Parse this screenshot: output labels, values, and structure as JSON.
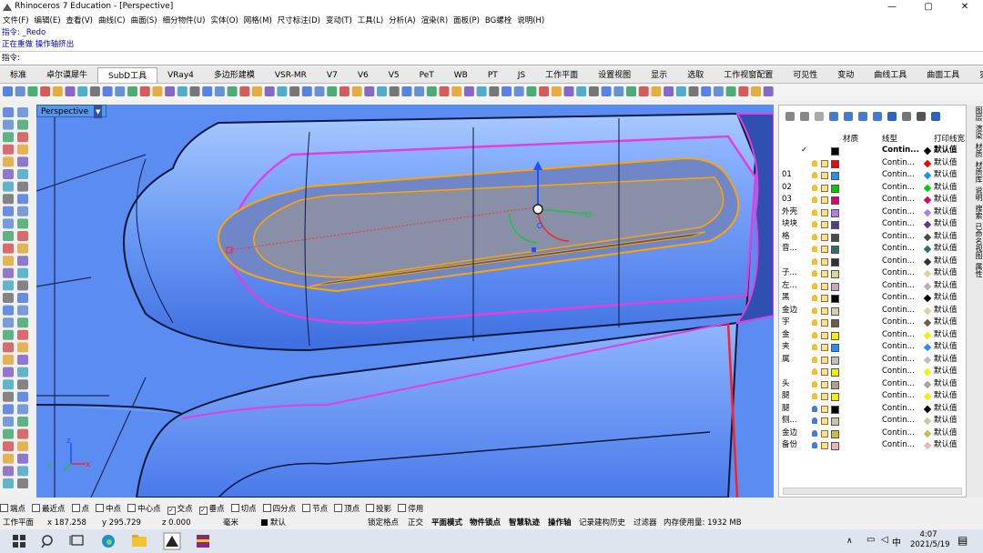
{
  "window": {
    "title": "Rhinoceros 7 Education - [Perspective]"
  },
  "menu": [
    "文件(F)",
    "编辑(E)",
    "查看(V)",
    "曲线(C)",
    "曲面(S)",
    "细分物件(U)",
    "实体(O)",
    "网格(M)",
    "尺寸标注(D)",
    "变动(T)",
    "工具(L)",
    "分析(A)",
    "渲染(R)",
    "面板(P)",
    "BG螺栓",
    "说明(H)"
  ],
  "command_history": {
    "line1": "指令: _Redo",
    "line2": "正在重做 操作轴挤出"
  },
  "command_prompt": "指令:",
  "tabs": [
    "标准",
    "卓尔谟犀牛",
    "SubD工具",
    "VRay4",
    "多边形建模",
    "VSR-MR",
    "V7",
    "V6",
    "V5",
    "PeT",
    "WB",
    "PT",
    "JS",
    "工作平面",
    "设置视图",
    "显示",
    "选取",
    "工作视窗配置",
    "可见性",
    "变动",
    "曲线工具",
    "曲面工具",
    "实体"
  ],
  "active_tab": "SubD工具",
  "viewport": {
    "label": "Perspective",
    "axis_x": "x",
    "axis_y": "y",
    "axis_z": "z"
  },
  "layers_panel": {
    "headers": {
      "material": "材质",
      "linetype": "线型",
      "print": "打印线宽"
    },
    "rows": [
      {
        "name": "",
        "color": "#000000",
        "linetype": "Contin...",
        "print": "默认值",
        "bold": true
      },
      {
        "name": "",
        "color": "#ff0000",
        "linetype": "Contin...",
        "print": "默认值"
      },
      {
        "name": "01",
        "color": "#1e90ff",
        "linetype": "Contin...",
        "print": "默认值"
      },
      {
        "name": "02",
        "color": "#00cc00",
        "linetype": "Contin...",
        "print": "默认值"
      },
      {
        "name": "03",
        "color": "#e0006b",
        "linetype": "Contin...",
        "print": "默认值"
      },
      {
        "name": "外壳",
        "color": "#b07ee0",
        "linetype": "Contin...",
        "print": "默认值"
      },
      {
        "name": "块块",
        "color": "#5a3a8a",
        "linetype": "Contin...",
        "print": "默认值"
      },
      {
        "name": "格",
        "color": "#4a4a4a",
        "linetype": "Contin...",
        "print": "默认值"
      },
      {
        "name": "音...",
        "color": "#2f6f6f",
        "linetype": "Contin...",
        "print": "默认值"
      },
      {
        "name": "",
        "color": "#333333",
        "linetype": "Contin...",
        "print": "默认值"
      },
      {
        "name": "子...",
        "color": "#d8d890",
        "linetype": "Contin...",
        "print": "默认值"
      },
      {
        "name": "左...",
        "color": "#c8a8b8",
        "linetype": "Contin...",
        "print": "默认值"
      },
      {
        "name": "黑",
        "color": "#000000",
        "linetype": "Contin...",
        "print": "默认值"
      },
      {
        "name": "金边",
        "color": "#d8d0a0",
        "linetype": "Contin...",
        "print": "默认值"
      },
      {
        "name": "字",
        "color": "#6a5a4a",
        "linetype": "Contin...",
        "print": "默认值"
      },
      {
        "name": "金",
        "color": "#f0f000",
        "linetype": "Contin...",
        "print": "默认值"
      },
      {
        "name": "夹",
        "color": "#1e90ff",
        "linetype": "Contin...",
        "print": "默认值"
      },
      {
        "name": "属",
        "color": "#c0c0c0",
        "linetype": "Contin...",
        "print": "默认值"
      },
      {
        "name": "",
        "color": "#f0f000",
        "linetype": "Contin...",
        "print": "默认值"
      },
      {
        "name": "头",
        "color": "#b0a090",
        "linetype": "Contin...",
        "print": "默认值"
      },
      {
        "name": "腿",
        "color": "#f0f000",
        "linetype": "Contin...",
        "print": "默认值"
      },
      {
        "name": "腿",
        "color": "#000000",
        "linetype": "Contin...",
        "print": "默认值"
      },
      {
        "name": "侧...",
        "color": "#c8c8a0",
        "linetype": "Contin...",
        "print": "默认值"
      },
      {
        "name": "金边",
        "color": "#c8c040",
        "linetype": "Contin...",
        "print": "默认值"
      },
      {
        "name": "备份",
        "color": "#f0b0c0",
        "linetype": "Contin...",
        "print": "默认值"
      }
    ]
  },
  "right_tabs": [
    "图层",
    "渲染",
    "材质",
    "材质库",
    "说明",
    "搜索",
    "已命名视图",
    "属性"
  ],
  "osnaps": [
    {
      "label": "端点",
      "checked": false
    },
    {
      "label": "最近点",
      "checked": false
    },
    {
      "label": "点",
      "checked": false
    },
    {
      "label": "中点",
      "checked": false
    },
    {
      "label": "中心点",
      "checked": false
    },
    {
      "label": "交点",
      "checked": true
    },
    {
      "label": "垂点",
      "checked": true
    },
    {
      "label": "切点",
      "checked": false
    },
    {
      "label": "四分点",
      "checked": false
    },
    {
      "label": "节点",
      "checked": false
    },
    {
      "label": "顶点",
      "checked": false
    },
    {
      "label": "投影",
      "checked": false
    },
    {
      "label": "停用",
      "checked": false
    }
  ],
  "status": {
    "cplane": "工作平面",
    "x": "x 187.258",
    "y": "y 295.729",
    "z": "z 0.000",
    "unit": "毫米",
    "layer": "默认",
    "modes": [
      "锁定格点",
      "正交",
      "平面模式",
      "物件锁点",
      "智慧轨迹",
      "操作轴",
      "记录建构历史",
      "过滤器"
    ],
    "memory": "内存使用量: 1932 MB"
  },
  "taskbar": {
    "ime": "中",
    "time": "4:07",
    "date": "2021/5/19"
  },
  "colors": {
    "viewport_bg": "#5a8cf2",
    "accent_orange": "#ffa500",
    "accent_magenta": "#e040e0"
  }
}
